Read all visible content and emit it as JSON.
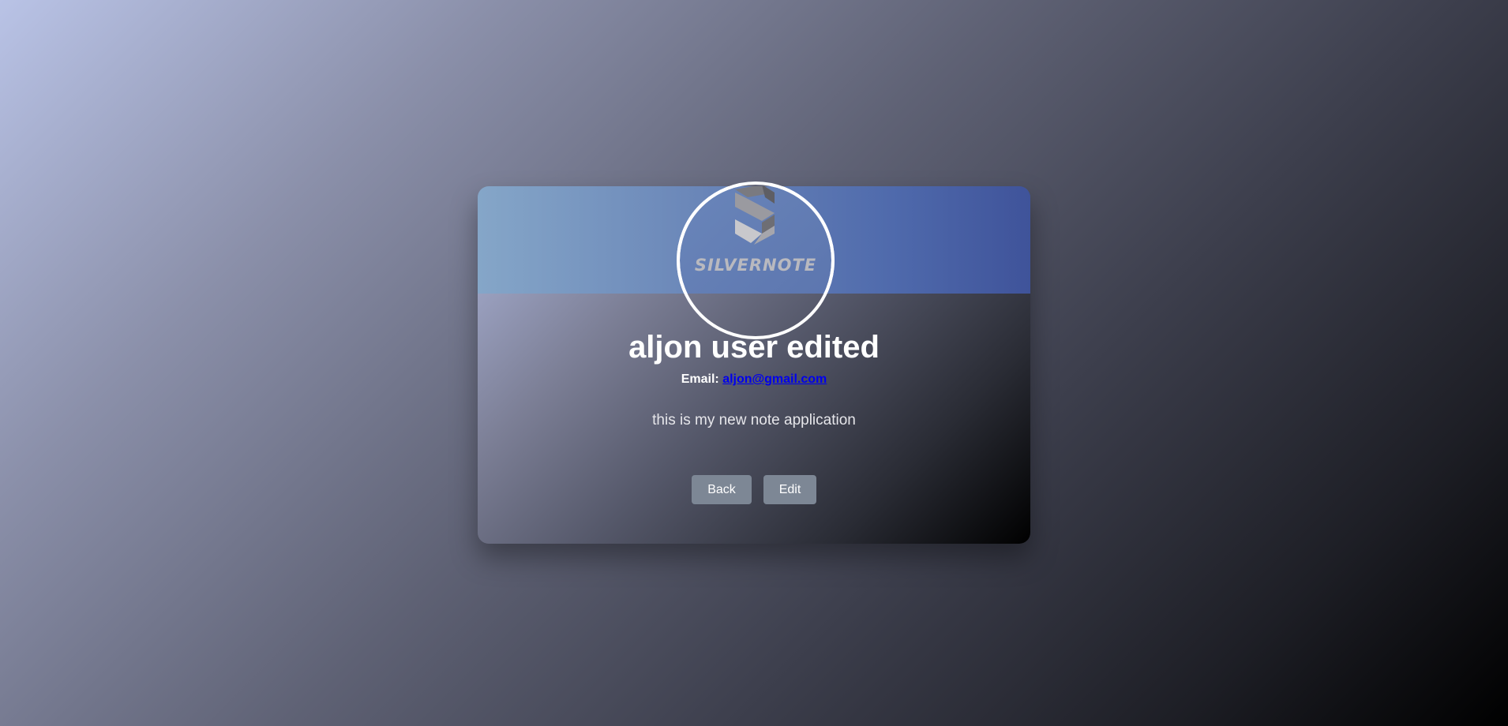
{
  "profile": {
    "name": "aljon user edited",
    "email_label": "Email:",
    "email": "aljon@gmail.com",
    "bio": "this is my new note application",
    "logo_text": "SILVERNOTE",
    "logo_icon": "silvernote-logo-icon"
  },
  "actions": {
    "back_label": "Back",
    "edit_label": "Edit"
  },
  "colors": {
    "header_start": "#85a6c8",
    "header_end": "#3f539a",
    "button_bg": "#7d8795",
    "link": "#0000ee",
    "ring": "#ffffff"
  }
}
